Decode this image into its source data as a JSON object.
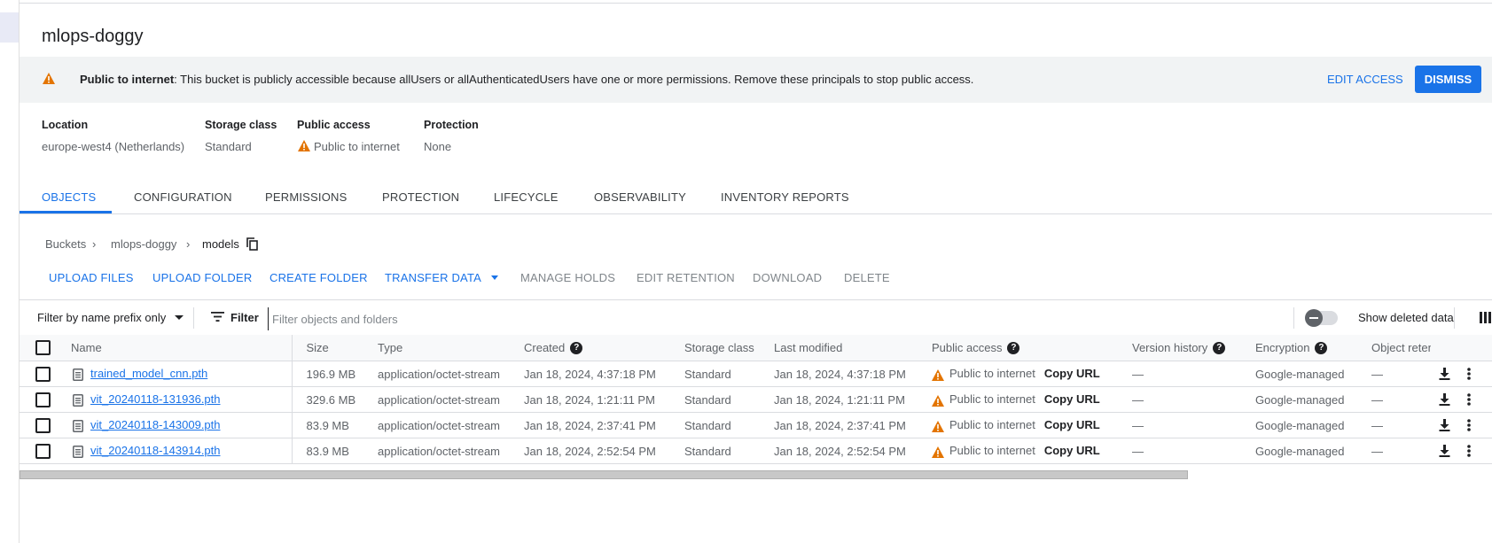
{
  "bucket": {
    "title": "mlops-doggy"
  },
  "banner": {
    "bold_text": "Public to internet",
    "message": ": This bucket is publicly accessible because allUsers or allAuthenticatedUsers have one or more permissions. Remove these principals to stop public access.",
    "edit_access": "EDIT ACCESS",
    "dismiss": "DISMISS"
  },
  "properties": {
    "location_label": "Location",
    "location_value": "europe-west4 (Netherlands)",
    "storage_class_label": "Storage class",
    "storage_class_value": "Standard",
    "public_access_label": "Public access",
    "public_access_value": "Public to internet",
    "protection_label": "Protection",
    "protection_value": "None"
  },
  "tabs": [
    "OBJECTS",
    "CONFIGURATION",
    "PERMISSIONS",
    "PROTECTION",
    "LIFECYCLE",
    "OBSERVABILITY",
    "INVENTORY REPORTS"
  ],
  "breadcrumb": {
    "root": "Buckets",
    "bucket": "mlops-doggy",
    "folder": "models"
  },
  "actions": {
    "upload_files": "UPLOAD FILES",
    "upload_folder": "UPLOAD FOLDER",
    "create_folder": "CREATE FOLDER",
    "transfer_data": "TRANSFER DATA",
    "manage_holds": "MANAGE HOLDS",
    "edit_retention": "EDIT RETENTION",
    "download": "DOWNLOAD",
    "delete": "DELETE"
  },
  "filter": {
    "prefix_label": "Filter by name prefix only",
    "filter_label": "Filter",
    "placeholder": "Filter objects and folders",
    "show_deleted": "Show deleted data"
  },
  "table": {
    "headers": {
      "name": "Name",
      "size": "Size",
      "type": "Type",
      "created": "Created",
      "storage_class": "Storage class",
      "last_modified": "Last modified",
      "public_access": "Public access",
      "version_history": "Version history",
      "encryption": "Encryption",
      "object_retention": "Object reten"
    },
    "copy_url": "Copy URL",
    "rows": [
      {
        "name": "trained_model_cnn.pth",
        "size": "196.9 MB",
        "type": "application/octet-stream",
        "created": "Jan 18, 2024, 4:37:18 PM",
        "storage_class": "Standard",
        "last_modified": "Jan 18, 2024, 4:37:18 PM",
        "public_access": "Public to internet",
        "version_history": "—",
        "encryption": "Google-managed",
        "retention": "—"
      },
      {
        "name": "vit_20240118-131936.pth",
        "size": "329.6 MB",
        "type": "application/octet-stream",
        "created": "Jan 18, 2024, 1:21:11 PM",
        "storage_class": "Standard",
        "last_modified": "Jan 18, 2024, 1:21:11 PM",
        "public_access": "Public to internet",
        "version_history": "—",
        "encryption": "Google-managed",
        "retention": "—"
      },
      {
        "name": "vit_20240118-143009.pth",
        "size": "83.9 MB",
        "type": "application/octet-stream",
        "created": "Jan 18, 2024, 2:37:41 PM",
        "storage_class": "Standard",
        "last_modified": "Jan 18, 2024, 2:37:41 PM",
        "public_access": "Public to internet",
        "version_history": "—",
        "encryption": "Google-managed",
        "retention": "—"
      },
      {
        "name": "vit_20240118-143914.pth",
        "size": "83.9 MB",
        "type": "application/octet-stream",
        "created": "Jan 18, 2024, 2:52:54 PM",
        "storage_class": "Standard",
        "last_modified": "Jan 18, 2024, 2:52:54 PM",
        "public_access": "Public to internet",
        "version_history": "—",
        "encryption": "Google-managed",
        "retention": "—"
      }
    ]
  },
  "colors": {
    "accent": "#1a73e8",
    "warning": "#e37400",
    "text": "#202124",
    "muted": "#5f6368"
  },
  "icons": {
    "warning": "warning-triangle-icon",
    "copy": "copy-icon",
    "file": "file-icon",
    "download": "download-icon",
    "more": "more-vert-icon",
    "filter": "filter-lines-icon",
    "columns": "column-display-icon",
    "help": "help-circle-icon"
  }
}
